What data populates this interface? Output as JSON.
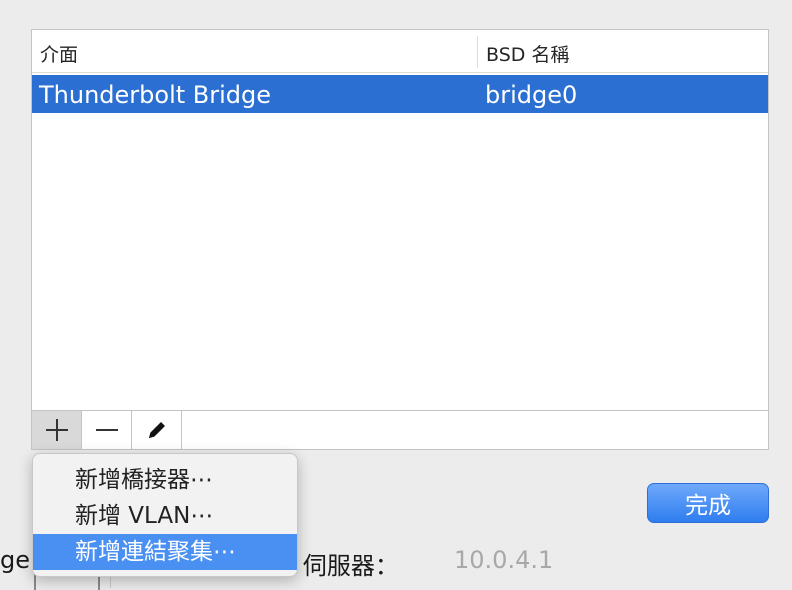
{
  "table": {
    "columns": [
      "介面",
      "BSD 名稱"
    ],
    "rows": [
      {
        "interface": "Thunderbolt Bridge",
        "bsd": "bridge0",
        "selected": true
      }
    ]
  },
  "toolbar": {
    "add_icon": "plus-icon",
    "remove_icon": "minus-icon",
    "edit_icon": "pencil-icon"
  },
  "menu": {
    "items": [
      {
        "label": "新增橋接器⋯"
      },
      {
        "label": "新增 VLAN⋯"
      },
      {
        "label": "新增連結聚集⋯",
        "highlighted": true
      }
    ]
  },
  "done_label": "完成",
  "background": {
    "left_fragment": "ge",
    "mid_fragment": "NS 伺服器：",
    "value_fragment": "10.0.4.1"
  },
  "colors": {
    "selection": "#2c6fd2",
    "menu_highlight": "#4a8ff2",
    "primary_button": "#3b84f4"
  }
}
